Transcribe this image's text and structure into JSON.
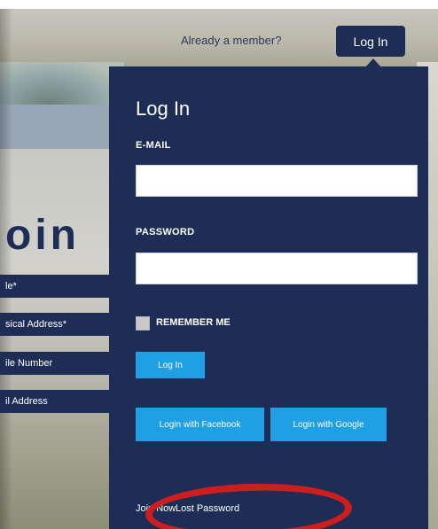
{
  "header": {
    "already_member": "Already a member?",
    "login_button": "Log In"
  },
  "background": {
    "join_title": "oin",
    "fields": [
      "le*",
      "sical Address*",
      "ile Number",
      "il Address"
    ]
  },
  "login_panel": {
    "title": "Log In",
    "email_label": "E-MAIL",
    "email_value": "",
    "password_label": "PASSWORD",
    "password_value": "",
    "remember_me_label": "REMEMBER ME",
    "remember_me_checked": false,
    "submit_label": "Log In",
    "facebook_label": "Login with Facebook",
    "google_label": "Login with Google",
    "join_now": "Join Now",
    "lost_password": "Lost Password"
  },
  "colors": {
    "panel": "#1d2d55",
    "button": "#1fa0e5",
    "highlight_oval": "#cc1e1e"
  }
}
